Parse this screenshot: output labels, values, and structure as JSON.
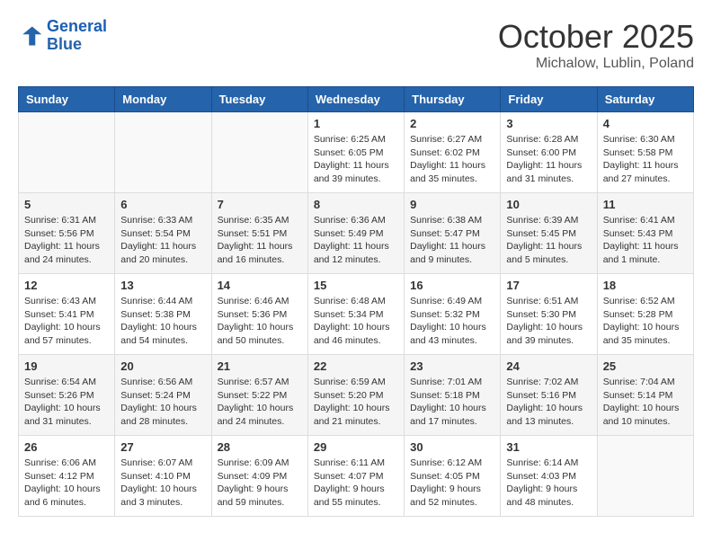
{
  "header": {
    "logo_line1": "General",
    "logo_line2": "Blue",
    "month": "October 2025",
    "location": "Michalow, Lublin, Poland"
  },
  "weekdays": [
    "Sunday",
    "Monday",
    "Tuesday",
    "Wednesday",
    "Thursday",
    "Friday",
    "Saturday"
  ],
  "weeks": [
    [
      {
        "day": "",
        "content": ""
      },
      {
        "day": "",
        "content": ""
      },
      {
        "day": "",
        "content": ""
      },
      {
        "day": "1",
        "content": "Sunrise: 6:25 AM\nSunset: 6:05 PM\nDaylight: 11 hours\nand 39 minutes."
      },
      {
        "day": "2",
        "content": "Sunrise: 6:27 AM\nSunset: 6:02 PM\nDaylight: 11 hours\nand 35 minutes."
      },
      {
        "day": "3",
        "content": "Sunrise: 6:28 AM\nSunset: 6:00 PM\nDaylight: 11 hours\nand 31 minutes."
      },
      {
        "day": "4",
        "content": "Sunrise: 6:30 AM\nSunset: 5:58 PM\nDaylight: 11 hours\nand 27 minutes."
      }
    ],
    [
      {
        "day": "5",
        "content": "Sunrise: 6:31 AM\nSunset: 5:56 PM\nDaylight: 11 hours\nand 24 minutes."
      },
      {
        "day": "6",
        "content": "Sunrise: 6:33 AM\nSunset: 5:54 PM\nDaylight: 11 hours\nand 20 minutes."
      },
      {
        "day": "7",
        "content": "Sunrise: 6:35 AM\nSunset: 5:51 PM\nDaylight: 11 hours\nand 16 minutes."
      },
      {
        "day": "8",
        "content": "Sunrise: 6:36 AM\nSunset: 5:49 PM\nDaylight: 11 hours\nand 12 minutes."
      },
      {
        "day": "9",
        "content": "Sunrise: 6:38 AM\nSunset: 5:47 PM\nDaylight: 11 hours\nand 9 minutes."
      },
      {
        "day": "10",
        "content": "Sunrise: 6:39 AM\nSunset: 5:45 PM\nDaylight: 11 hours\nand 5 minutes."
      },
      {
        "day": "11",
        "content": "Sunrise: 6:41 AM\nSunset: 5:43 PM\nDaylight: 11 hours\nand 1 minute."
      }
    ],
    [
      {
        "day": "12",
        "content": "Sunrise: 6:43 AM\nSunset: 5:41 PM\nDaylight: 10 hours\nand 57 minutes."
      },
      {
        "day": "13",
        "content": "Sunrise: 6:44 AM\nSunset: 5:38 PM\nDaylight: 10 hours\nand 54 minutes."
      },
      {
        "day": "14",
        "content": "Sunrise: 6:46 AM\nSunset: 5:36 PM\nDaylight: 10 hours\nand 50 minutes."
      },
      {
        "day": "15",
        "content": "Sunrise: 6:48 AM\nSunset: 5:34 PM\nDaylight: 10 hours\nand 46 minutes."
      },
      {
        "day": "16",
        "content": "Sunrise: 6:49 AM\nSunset: 5:32 PM\nDaylight: 10 hours\nand 43 minutes."
      },
      {
        "day": "17",
        "content": "Sunrise: 6:51 AM\nSunset: 5:30 PM\nDaylight: 10 hours\nand 39 minutes."
      },
      {
        "day": "18",
        "content": "Sunrise: 6:52 AM\nSunset: 5:28 PM\nDaylight: 10 hours\nand 35 minutes."
      }
    ],
    [
      {
        "day": "19",
        "content": "Sunrise: 6:54 AM\nSunset: 5:26 PM\nDaylight: 10 hours\nand 31 minutes."
      },
      {
        "day": "20",
        "content": "Sunrise: 6:56 AM\nSunset: 5:24 PM\nDaylight: 10 hours\nand 28 minutes."
      },
      {
        "day": "21",
        "content": "Sunrise: 6:57 AM\nSunset: 5:22 PM\nDaylight: 10 hours\nand 24 minutes."
      },
      {
        "day": "22",
        "content": "Sunrise: 6:59 AM\nSunset: 5:20 PM\nDaylight: 10 hours\nand 21 minutes."
      },
      {
        "day": "23",
        "content": "Sunrise: 7:01 AM\nSunset: 5:18 PM\nDaylight: 10 hours\nand 17 minutes."
      },
      {
        "day": "24",
        "content": "Sunrise: 7:02 AM\nSunset: 5:16 PM\nDaylight: 10 hours\nand 13 minutes."
      },
      {
        "day": "25",
        "content": "Sunrise: 7:04 AM\nSunset: 5:14 PM\nDaylight: 10 hours\nand 10 minutes."
      }
    ],
    [
      {
        "day": "26",
        "content": "Sunrise: 6:06 AM\nSunset: 4:12 PM\nDaylight: 10 hours\nand 6 minutes."
      },
      {
        "day": "27",
        "content": "Sunrise: 6:07 AM\nSunset: 4:10 PM\nDaylight: 10 hours\nand 3 minutes."
      },
      {
        "day": "28",
        "content": "Sunrise: 6:09 AM\nSunset: 4:09 PM\nDaylight: 9 hours\nand 59 minutes."
      },
      {
        "day": "29",
        "content": "Sunrise: 6:11 AM\nSunset: 4:07 PM\nDaylight: 9 hours\nand 55 minutes."
      },
      {
        "day": "30",
        "content": "Sunrise: 6:12 AM\nSunset: 4:05 PM\nDaylight: 9 hours\nand 52 minutes."
      },
      {
        "day": "31",
        "content": "Sunrise: 6:14 AM\nSunset: 4:03 PM\nDaylight: 9 hours\nand 48 minutes."
      },
      {
        "day": "",
        "content": ""
      }
    ]
  ]
}
